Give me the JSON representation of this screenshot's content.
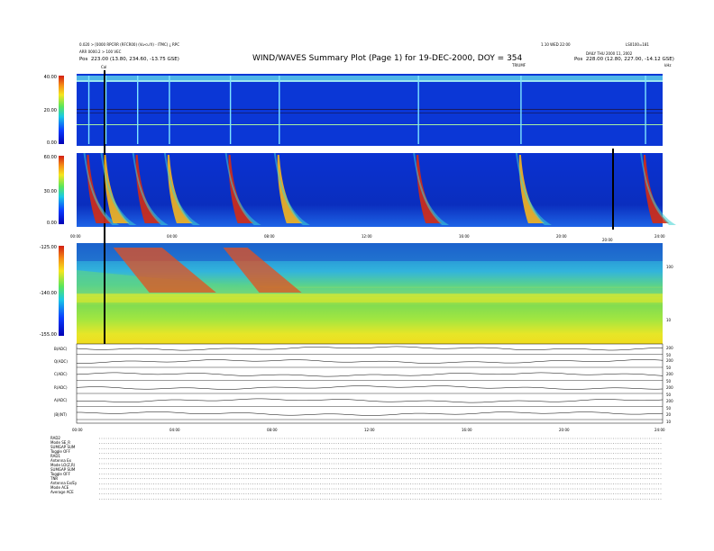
{
  "header": {
    "left_line1": "0.020 > [0000 RPCRR (RFCR00) (Vu<u'ñ) - ITMC) ¿ RPC",
    "left_line2": "ARR 0000.2 > 100 VEC",
    "left_pos_label": "Pos",
    "left_pos_value": "223.00 (13.80, 234.60, -13.75 GSE)",
    "title": "WIND/WAVES Summary Plot (Page 1) for 19-DEC-2000, DOY = 354",
    "right_line1": "1.10 WED 22:00",
    "right_line2": "DAILY THU 2000 11, 2002",
    "right_line3": "LS0100=181",
    "right_pos_label": "Pos",
    "right_pos_value": "228.00 (12.80, 227.00, -14.12 GSE)",
    "event_label": "Cal",
    "mid_label": "TRIUMF",
    "right_marker": "0.6",
    "right_marker2": "kHz"
  },
  "panels": {
    "rad2": {
      "label": "RAD2",
      "ticks": [
        "40.00",
        "20.00",
        "0.00"
      ]
    },
    "rad1": {
      "label": "RAD1",
      "ticks": [
        "60.00",
        "30.00",
        "0.00"
      ]
    },
    "tnr": {
      "label": "TNR",
      "ticks": [
        "-125.00",
        "-140.00",
        "-155.00"
      ],
      "right_ticks": [
        "100",
        "10"
      ]
    }
  },
  "time_axis": {
    "labels": [
      "00:00",
      "04:00",
      "08:00",
      "12:00",
      "16:00",
      "20:00",
      "24:00"
    ],
    "side_label": "20:00"
  },
  "line_panels": [
    {
      "label": "B(ADC)",
      "r1": "200",
      "r2": "50"
    },
    {
      "label": "Q(ADC)",
      "r1": "200",
      "r2": "50"
    },
    {
      "label": "C(ADC)",
      "r1": "200",
      "r2": "50"
    },
    {
      "label": "R(ADC)",
      "r1": "200",
      "r2": "50"
    },
    {
      "label": "A(ADC)",
      "r1": "200",
      "r2": "50"
    },
    {
      "label": "|B|(NT)",
      "r1": "20",
      "r2": "10"
    }
  ],
  "bottom_axis": [
    "00:00",
    "04:00",
    "08:00",
    "12:00",
    "16:00",
    "20:00",
    "24:00"
  ],
  "footer_rows": [
    {
      "k": "RAD2",
      "v": ""
    },
    {
      "k": "Mode",
      "v": "SE_R"
    },
    {
      "k": "SUMGAP",
      "v": "SUM"
    },
    {
      "k": "Toggle",
      "v": "OFF"
    },
    {
      "k": "RAD1",
      "v": ""
    },
    {
      "k": "Antenna",
      "v": "Ex"
    },
    {
      "k": "Mode",
      "v": "LO(Z,R)"
    },
    {
      "k": "SUMGAP",
      "v": "SUM"
    },
    {
      "k": "Toggle",
      "v": "OFF"
    },
    {
      "k": "TNR",
      "v": ""
    },
    {
      "k": "Antenna",
      "v": "Ex/Ey"
    },
    {
      "k": "Mode",
      "v": "ACE"
    },
    {
      "k": "Average",
      "v": "ACE"
    }
  ],
  "colors": {
    "background": "#ffffff",
    "spectrogram_low": "#0a2bd6",
    "spectrogram_mid": "#19c8c8",
    "spectrogram_high": "#d42c14"
  },
  "chart_data": {
    "type": "heatmap",
    "title": "WIND/WAVES Summary Plot (Page 1) for 19-DEC-2000, DOY = 354",
    "xlabel": "",
    "x_range_hours": [
      0,
      24
    ],
    "radio_bursts_hours": [
      0.5,
      1.2,
      2.5,
      3.8,
      6.3,
      8.3,
      14.0,
      18.2,
      23.3
    ],
    "tnr_bands_hours": [
      [
        1.5,
        3.5
      ],
      [
        6.0,
        7.0
      ]
    ]
  }
}
